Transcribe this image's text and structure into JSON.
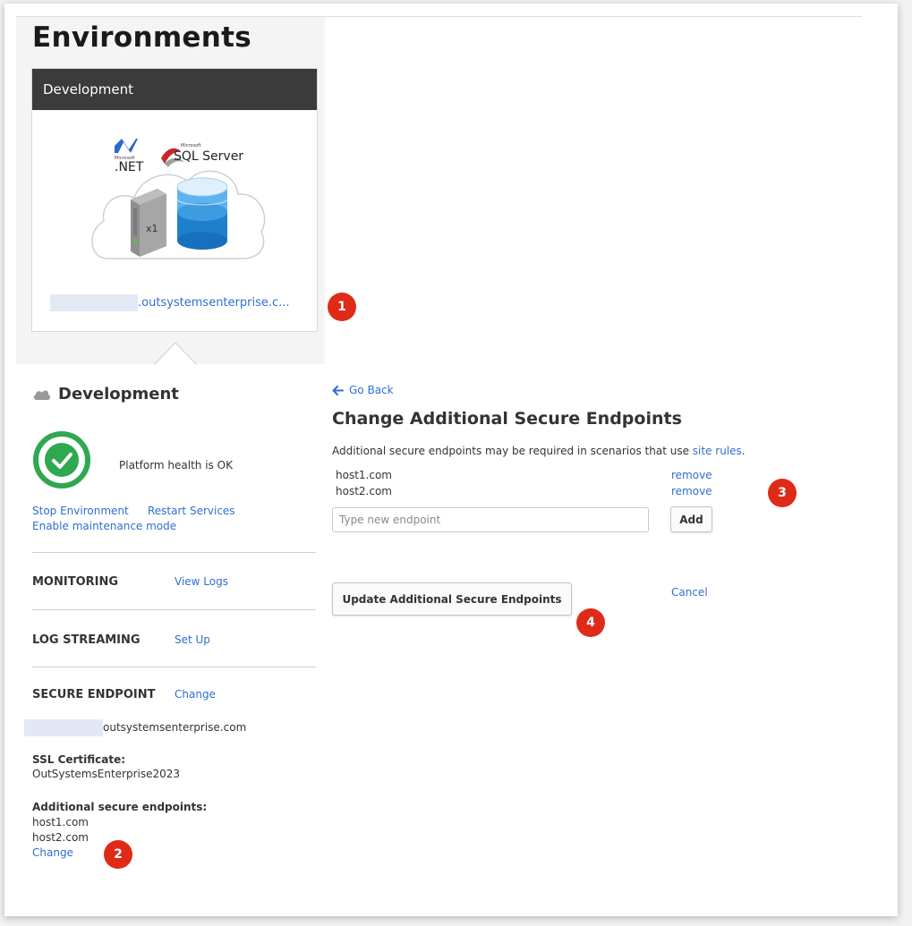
{
  "page": {
    "title": "Environments"
  },
  "environment_card": {
    "header": "Development",
    "illustration": {
      "net_brand": "Microsoft",
      "net_label": ".NET",
      "sql_brand": "Microsoft",
      "sql_label": "SQL Server",
      "server_count": "x1"
    },
    "url_suffix": ".outsystemsenterprise.c..."
  },
  "callouts": [
    "1",
    "2",
    "3",
    "4"
  ],
  "details": {
    "title": "Development",
    "health_text": "Platform health is OK",
    "actions": {
      "stop": "Stop Environment",
      "restart": "Restart Services",
      "maintenance": "Enable maintenance mode"
    },
    "monitoring": {
      "label": "MONITORING",
      "link": "View Logs"
    },
    "log_streaming": {
      "label": "LOG STREAMING",
      "link": "Set Up"
    },
    "secure_endpoint": {
      "label": "SECURE ENDPOINT",
      "link": "Change",
      "domain_suffix": "outsystemsenterprise.com",
      "ssl_label": "SSL Certificate:",
      "ssl_value": "OutSystemsEnterprise2023",
      "additional_label": "Additional secure endpoints:",
      "additional": [
        "host1.com",
        "host2.com"
      ],
      "change_link": "Change"
    }
  },
  "form": {
    "go_back": "Go Back",
    "title": "Change Additional Secure Endpoints",
    "description_prefix": "Additional secure endpoints may be required in scenarios that use ",
    "description_link": "site rules",
    "description_suffix": ".",
    "endpoints": [
      {
        "host": "host1.com",
        "action": "remove"
      },
      {
        "host": "host2.com",
        "action": "remove"
      }
    ],
    "input_placeholder": "Type new endpoint",
    "input_value": "",
    "add_button": "Add",
    "update_button": "Update Additional Secure Endpoints",
    "cancel_link": "Cancel"
  },
  "colors": {
    "link": "#2e6fd1",
    "badge": "#e02a18",
    "health_ok": "#2fa84f",
    "card_header": "#3b3b3b"
  }
}
